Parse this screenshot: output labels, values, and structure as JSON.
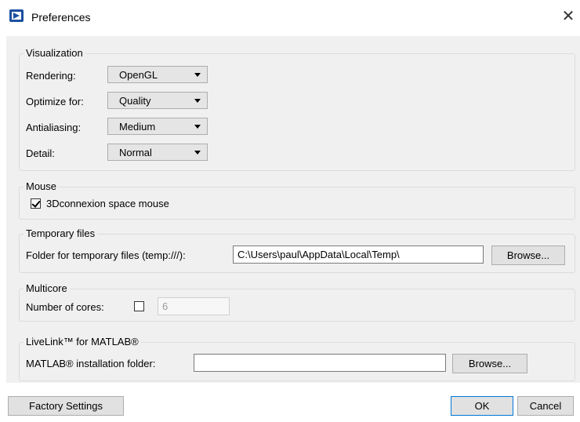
{
  "window": {
    "title": "Preferences",
    "app_icon": "comsol-icon",
    "close_glyph": "✕"
  },
  "visualization": {
    "legend": "Visualization",
    "rows": [
      {
        "label": "Rendering:",
        "value": "OpenGL"
      },
      {
        "label": "Optimize for:",
        "value": "Quality"
      },
      {
        "label": "Antialiasing:",
        "value": "Medium"
      },
      {
        "label": "Detail:",
        "value": "Normal"
      }
    ]
  },
  "mouse": {
    "legend": "Mouse",
    "space_mouse_label": "3Dconnexion space mouse",
    "space_mouse_checked": true
  },
  "temp_files": {
    "legend": "Temporary files",
    "folder_label": "Folder for temporary files (temp:///):",
    "folder_value": "C:\\Users\\paul\\AppData\\Local\\Temp\\",
    "browse_label": "Browse..."
  },
  "multicore": {
    "legend": "Multicore",
    "cores_label": "Number of cores:",
    "cores_checked": false,
    "cores_value": "6"
  },
  "livelink": {
    "legend": "LiveLink™ for MATLAB®",
    "folder_label": "MATLAB® installation folder:",
    "folder_value": "",
    "browse_label": "Browse..."
  },
  "footer": {
    "factory_label": "Factory Settings",
    "ok_label": "OK",
    "cancel_label": "Cancel"
  },
  "colors": {
    "accent": "#0078d7",
    "panel_bg": "#f0f0f0",
    "icon_blue": "#1c4fa0"
  }
}
